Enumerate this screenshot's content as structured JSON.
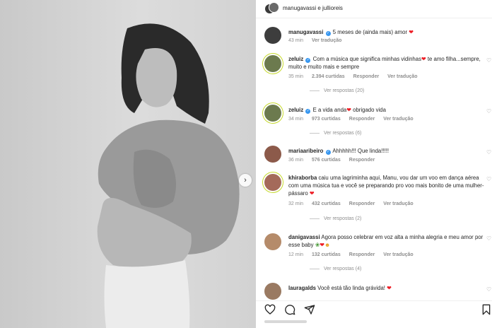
{
  "header": {
    "title": "manugavassi e jullioreis"
  },
  "caption": {
    "user": "manugavassi",
    "text": "5 meses de (ainda mais) amor",
    "time": "43 min",
    "translate": "Ver tradução"
  },
  "comments": [
    {
      "user": "zeluiz",
      "text": "Com a música que significa minhas vidinhas",
      "text2": " te amo filha...sempre, muito e muito mais e sempre",
      "time": "35 min",
      "likes": "2.394 curtidas",
      "reply": "Responder",
      "translate": "Ver tradução",
      "replies": "Ver respostas (20)"
    },
    {
      "user": "zeluiz",
      "text": "E a vida anda",
      "text2": " obrigado vida",
      "time": "34 min",
      "likes": "973 curtidas",
      "reply": "Responder",
      "translate": "Ver tradução",
      "replies": "Ver respostas (6)"
    },
    {
      "user": "mariaaribeiro",
      "text": "Ahhhhh!!! Que linda!!!!!",
      "time": "36 min",
      "likes": "576 curtidas",
      "reply": "Responder"
    },
    {
      "user": "khiraborba",
      "text": "caiu uma lagriminha aqui, Manu, vou dar um voo em dança aérea com uma música tua e você se preparando pro voo mais bonito de uma mulher-pássaro",
      "time": "32 min",
      "likes": "432 curtidas",
      "reply": "Responder",
      "translate": "Ver tradução",
      "replies": "Ver respostas (2)"
    },
    {
      "user": "danigavassi",
      "text": "Agora posso celebrar em voz alta a minha alegria e meu amor por esse baby",
      "time": "12 min",
      "likes": "132 curtidas",
      "reply": "Responder",
      "translate": "Ver tradução",
      "replies": "Ver respostas (4)"
    },
    {
      "user": "lauragalds",
      "text": "Você está tão linda grávida!"
    }
  ],
  "icons": {
    "next": "chevron-right-icon",
    "like": "heart-icon",
    "comment": "comment-icon",
    "share": "share-icon",
    "save": "bookmark-icon",
    "verified": "verified-badge-icon"
  },
  "colors": {
    "accent": "#3897f0",
    "heart": "#ed1c24",
    "muted": "#8e8e8e"
  }
}
